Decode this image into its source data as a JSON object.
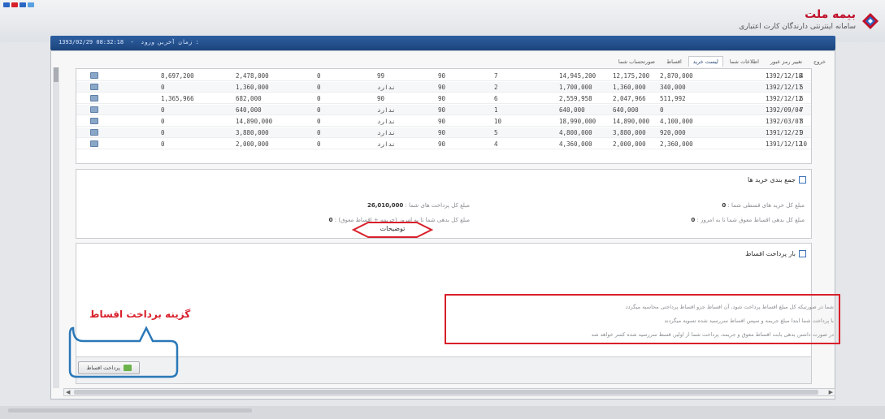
{
  "header": {
    "company": "بیمه ملت",
    "system_title": "سامانه اینترنتی دارندگان کارت اعتباری",
    "last_login": "زمان آخرین ورود :",
    "last_login_value": "1393/02/29 08:32:18"
  },
  "tabs": [
    {
      "label": "صورتحساب شما",
      "active": false
    },
    {
      "label": "اقساط",
      "active": false
    },
    {
      "label": "لیست خرید",
      "active": true
    },
    {
      "label": "اطلاعات شما",
      "active": false
    },
    {
      "label": "تغییر رمز عبور",
      "active": false
    },
    {
      "label": "خروج",
      "active": false
    }
  ],
  "table": {
    "rows": [
      [
        "1392/12/18",
        "4",
        "2,870,000",
        "12,175,200",
        "14,945,200",
        "7",
        "90",
        "99",
        "0",
        "2,478,000",
        "8,697,200"
      ],
      [
        "1392/12/17",
        "5",
        "340,000",
        "1,360,000",
        "1,700,000",
        "2",
        "90",
        "ندارد",
        "0",
        "1,360,000",
        "0"
      ],
      [
        "1392/12/12",
        "6",
        "511,992",
        "2,047,966",
        "2,559,958",
        "6",
        "90",
        "90",
        "0",
        "682,000",
        "1,365,966"
      ],
      [
        "1392/09/04",
        "7",
        "0",
        "640,000",
        "640,000",
        "1",
        "90",
        "ندارد",
        "0",
        "640,000",
        "0"
      ],
      [
        "1392/03/07",
        "8",
        "4,100,000",
        "14,890,000",
        "18,990,000",
        "10",
        "90",
        "ندارد",
        "0",
        "14,890,000",
        "0"
      ],
      [
        "1391/12/21",
        "9",
        "920,000",
        "3,880,000",
        "4,800,000",
        "5",
        "90",
        "ندارد",
        "0",
        "3,880,000",
        "0"
      ],
      [
        "1391/12/12",
        "10",
        "2,360,000",
        "2,000,000",
        "4,360,000",
        "4",
        "90",
        "ندارد",
        "0",
        "2,000,000",
        "0"
      ]
    ]
  },
  "summary": {
    "title": "جمع بندی خرید ها",
    "total_purchases_label": "مبلغ کل خرید های قسطی شما :",
    "total_purchases_value": "0",
    "total_payments_label": "مبلغ کل پرداخت های شما :",
    "total_payments_value": "26,010,000",
    "remaining_label": "مبلغ کل بدهی اقساط معوق شما تا به امروز :",
    "remaining_value": "0",
    "remaining_with_penalty_label": "مبلغ کل بدهی شما تا به امروز (جریمه + اقساط معوق) :",
    "remaining_with_penalty_value": "0"
  },
  "installments": {
    "title": "بار پرداخت اقساط",
    "notes_label": "توضیحات",
    "notes": [
      "شما در صورتیکه کل مبلغ اقساط پرداخت شود، آن اقساط جزو اقساط پرداختی محاسبه میگردد",
      "با پرداخت شما ابتدا مبلغ جریمه و سپس اقساط سررسید شده تسویه میگردند",
      "در صورت داشتن بدهی بابت اقساط معوق و جریمه، پرداخت شما از اولین قسط سررسید شده کسر خواهد شد"
    ],
    "annotation": "گزینه برداخت اقساط",
    "pay_button": "پرداخت اقساط"
  },
  "colors": {
    "brand_red": "#c0102a",
    "header_blue": "#1c447c",
    "annotation_red": "#d8202a",
    "annotation_blue": "#2a78b8"
  }
}
